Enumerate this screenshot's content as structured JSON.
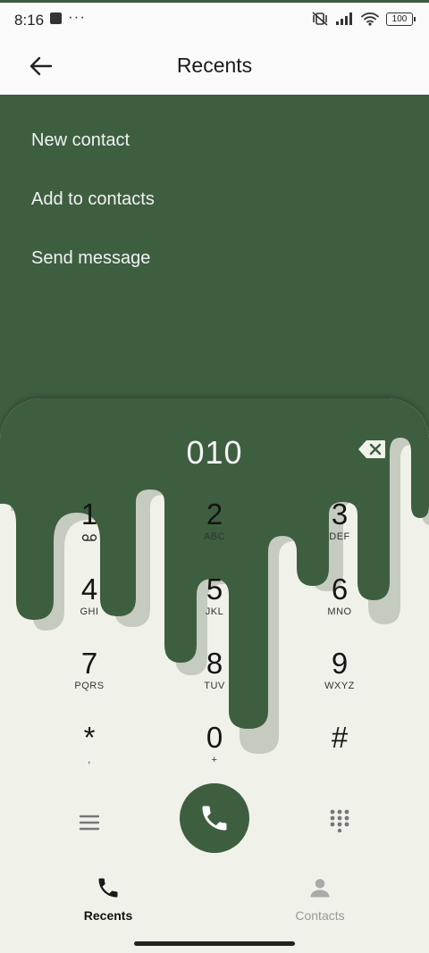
{
  "status": {
    "time": "8:16",
    "battery": "100"
  },
  "header": {
    "title": "Recents"
  },
  "menu": {
    "items": [
      "New contact",
      "Add to contacts",
      "Send message"
    ]
  },
  "dialer": {
    "number": "010",
    "keys": [
      {
        "digit": "1",
        "letters": ""
      },
      {
        "digit": "2",
        "letters": "ABC"
      },
      {
        "digit": "3",
        "letters": "DEF"
      },
      {
        "digit": "4",
        "letters": "GHI"
      },
      {
        "digit": "5",
        "letters": "JKL"
      },
      {
        "digit": "6",
        "letters": "MNO"
      },
      {
        "digit": "7",
        "letters": "PQRS"
      },
      {
        "digit": "8",
        "letters": "TUV"
      },
      {
        "digit": "9",
        "letters": "WXYZ"
      },
      {
        "digit": "*",
        "letters": ","
      },
      {
        "digit": "0",
        "letters": "+"
      },
      {
        "digit": "#",
        "letters": ""
      }
    ]
  },
  "nav": {
    "recents": "Recents",
    "contacts": "Contacts"
  },
  "colors": {
    "accent": "#3e5e40",
    "background": "#f0f2ea"
  }
}
